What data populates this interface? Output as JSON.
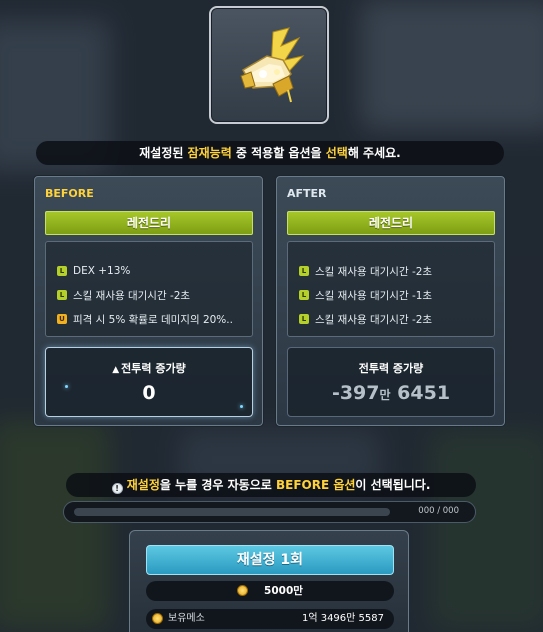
{
  "notice_top": {
    "p1": "재설정된 ",
    "hl1": "잠재능력",
    "p2": " 중 적용할 옵션을 ",
    "hl2": "선택",
    "p3": "해 주세요."
  },
  "before": {
    "title": "BEFORE",
    "grade": "레전드리",
    "options": [
      {
        "badge": "L",
        "text": "DEX +13%"
      },
      {
        "badge": "L",
        "text": "스킬 재사용 대기시간 -2초"
      },
      {
        "badge": "U",
        "text": "피격 시 5% 확률로 데미지의 20%.."
      }
    ],
    "power_label": "전투력 증가량",
    "power_value": "0"
  },
  "after": {
    "title": "AFTER",
    "grade": "레전드리",
    "options": [
      {
        "badge": "L",
        "text": "스킬 재사용 대기시간 -2초"
      },
      {
        "badge": "L",
        "text": "스킬 재사용 대기시간 -1초"
      },
      {
        "badge": "L",
        "text": "스킬 재사용 대기시간 -2초"
      }
    ],
    "power_label": "전투력 증가량",
    "power_value_a": "-397",
    "power_value_unit": "만",
    "power_value_b": " 6451"
  },
  "notice_bottom": {
    "icon": "!",
    "hl1": "재설정",
    "p1": "을 누를 경우 자동으로 ",
    "hl2": "BEFORE 옵션",
    "p2": "이 선택됩니다."
  },
  "progress": {
    "value": 0,
    "text": "000 / 000"
  },
  "reset": {
    "label": "재설정 1회"
  },
  "cost": {
    "value": "5000만"
  },
  "owned": {
    "label": "보유메소",
    "value": "1억 3496만 5587"
  },
  "colors": {
    "accent_yellow": "#ffd23a",
    "legendary_green": "#9bbd22",
    "button_blue": "#3fb0d2"
  }
}
